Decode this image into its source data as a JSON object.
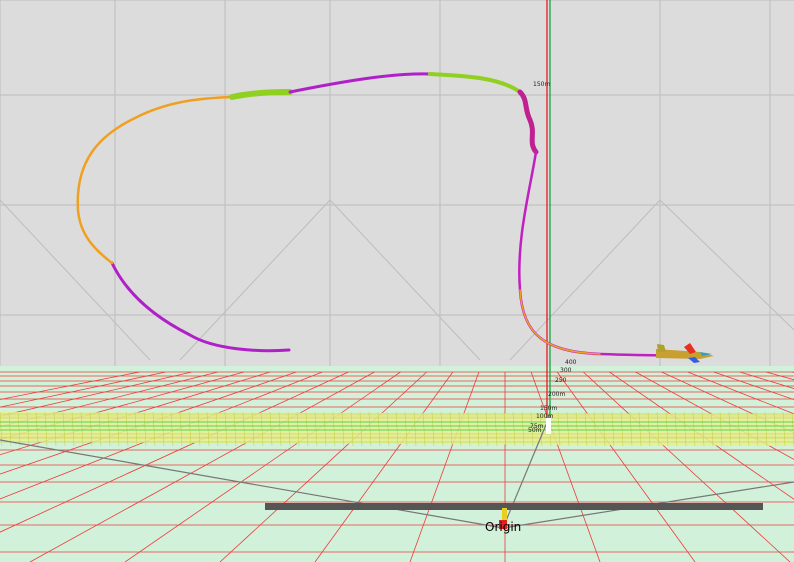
{
  "scene": {
    "origin_label": "Origin",
    "altitude_marker": "150m",
    "range_labels": [
      "400",
      "300",
      "250",
      "200m",
      "150m",
      "100m",
      "75m",
      "50m"
    ],
    "colors": {
      "sky": "#dcdcdc",
      "sky_grid": "#bdbdbd",
      "ground": "#d2f1da",
      "ground_grid": "#ee3a3a",
      "runway_fill": "#e8f190",
      "runway_grid": "#b8c83a",
      "runway_lines": "#33cc55",
      "trail_a": "#f0a020",
      "trail_b": "#b020c8",
      "trail_c": "#90d020",
      "axis_red": "#e02020",
      "axis_green": "#20a040",
      "taxiway": "#555555"
    }
  }
}
